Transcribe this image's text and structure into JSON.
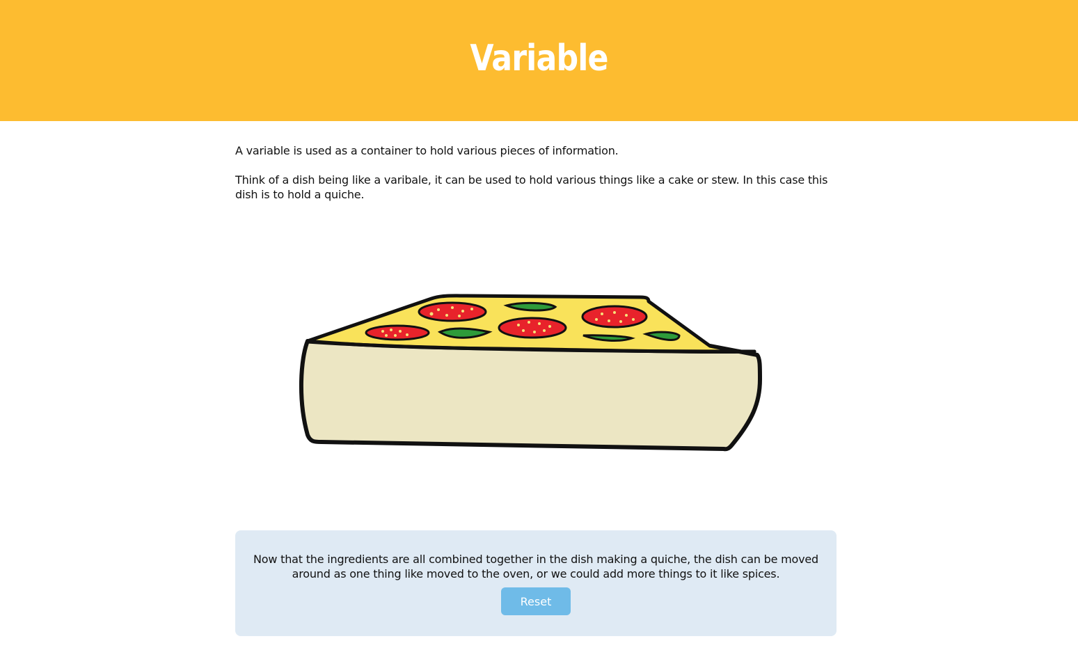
{
  "header": {
    "title": "Variable",
    "background_color": "#fdbc30"
  },
  "main": {
    "paragraphs": [
      "A variable is used as a container to hold various pieces of information.",
      "Think of a dish being like a varibale, it can be used to hold various things like a cake or stew. In this case this dish is to hold a quiche."
    ],
    "illustration": {
      "subject": "quiche-in-dish",
      "colors": {
        "filling_top": "#f9e25a",
        "crust": "#ece6c3",
        "tomato": "#e8232b",
        "leaf": "#2e9b3a",
        "outline": "#111111"
      }
    }
  },
  "info_box": {
    "text": "Now that the ingredients are all combined together in the dish making a quiche, the dish can be moved around as one thing like moved to the oven, or we could add more things to it like spices.",
    "background_color": "#dfeaf4",
    "reset_label": "Reset",
    "button_color": "#6fbbe8"
  }
}
